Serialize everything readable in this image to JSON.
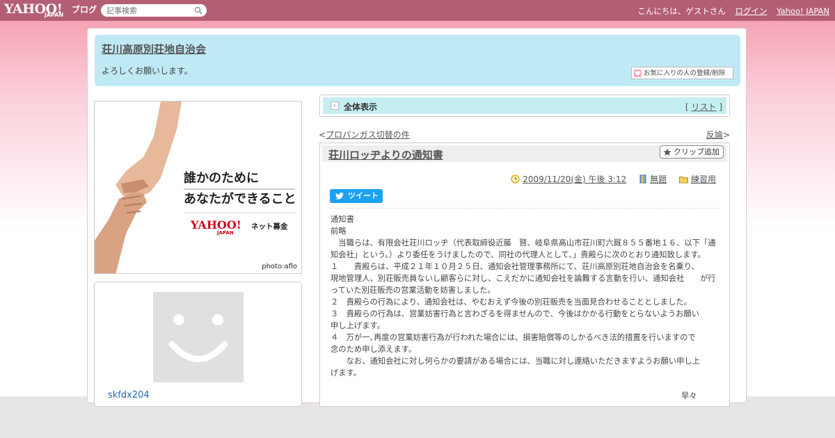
{
  "topbar": {
    "logo_text": "YAHOO!",
    "logo_sub": "JAPAN",
    "logo_blog": "ブログ",
    "search_placeholder": "記事検索",
    "greeting": "こんにちは、ゲストさん",
    "login": "ログイン",
    "yahoo_japan": "Yahoo! JAPAN"
  },
  "header": {
    "title": "荘川高原別荘地自治会",
    "description": "よろしくお願いします。",
    "fav_button": "お気に入りの人の登録/削除"
  },
  "ad": {
    "line1": "誰かのために",
    "line2": "あなたができること",
    "logo_text": "YAHOO!",
    "logo_sub": "JAPAN",
    "sub": "ネット募金",
    "credit": "photo:aflo"
  },
  "profile": {
    "name": "skfdx204"
  },
  "nav": {
    "view_all": "全体表示",
    "list_open": "[ ",
    "list_label": "リスト",
    "list_close": " ]"
  },
  "pager": {
    "prev_label": "プロパンガス切替の件",
    "next_label": "反論"
  },
  "article": {
    "title": "荘川ロッヂよりの通知書",
    "clip_button": "クリップ追加",
    "date": "2009/11/20(金) 午後 3:12",
    "tag": "無題",
    "category": "練習用",
    "tweet": "ツイート",
    "body": [
      "通知書",
      "前略",
      "　当職らは、有限会社荘川ロッヂ（代表取締役近藤　賢、岐阜県高山市荘川町六厩８５５番地１６、以下「通知会社」という。）より委任をうけましたので、同社の代理人として、」貴殿らに次のとおり通知致します。",
      "１　　貴殿らは、平成２１年１０月２５日、通知会社管理事務所にて、荘川高原別荘地自治会を名乗り、　　現地管理人、別荘販売員ないし顧客らに対し、こえだかに通知会社を論難する言動を行い、通知会社　　が行っていた別荘販売の営業活動を妨害しました。",
      "２　貴殿らの行為により、通知会社は、やむおえず今後の別荘販売を当面見合わせることとしました。",
      "３　貴殿らの行為は、営業妨害行為と言わざるを得ませんので、今後はかかる行動をとらないようお願い　　申し上げます。",
      "４　万が一､再度の営業妨害行為が行われた場合には、損害賠償等のしかるべき法的措置を行いますので　　念のため申し添えます。",
      "　　なお、通知会社に対し何らかの要請がある場合には、当職に対し連絡いただきますようお願い申し上　　げます。"
    ],
    "closing": "早々"
  },
  "colors": {
    "topbar": "#b45e74",
    "header_box": "#bfe9f5",
    "nav_bar": "#c5eef2",
    "tweet": "#1da1f2",
    "link_blue": "#2467b5"
  }
}
